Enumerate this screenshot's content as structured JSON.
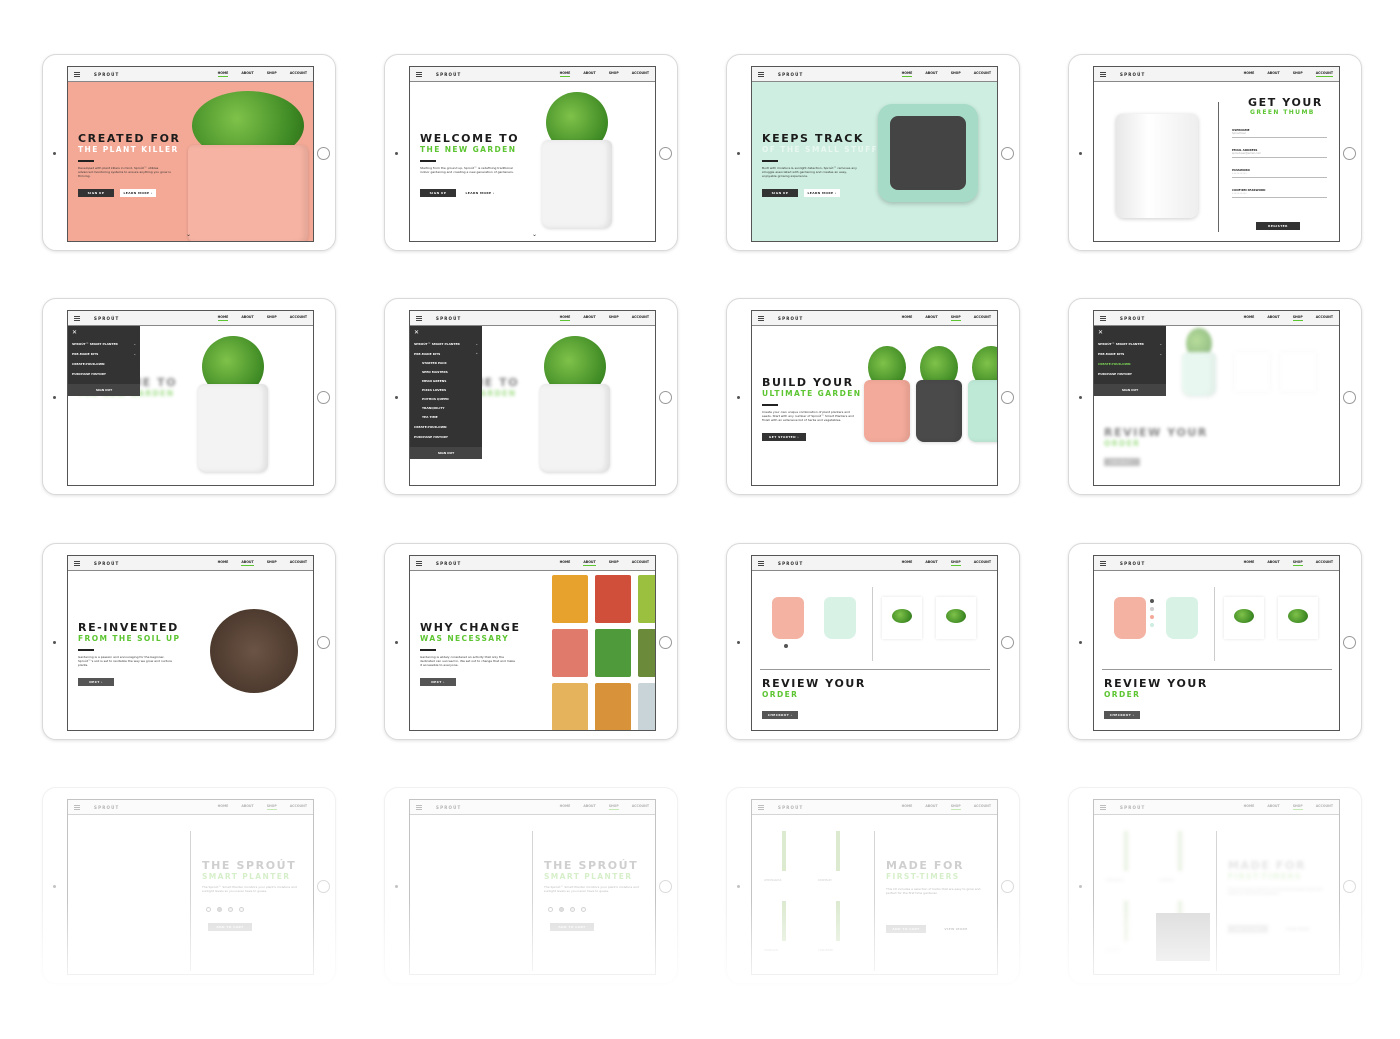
{
  "brand": "SPROÚT",
  "nav": [
    "HOME",
    "ABOUT",
    "SHOP",
    "ACCOUNT"
  ],
  "colors": {
    "accent": "#5cc531",
    "coral": "#f4a996",
    "mint": "#cdeee0",
    "dark": "#333333"
  },
  "cards": [
    {
      "view": "hero",
      "bg": "#f4a996",
      "active": 0,
      "h1": "CREATED FOR",
      "h2": "THE PLANT KILLER",
      "h2color": "#ffffff",
      "body": "Developed with plant killers in mind, Sproút™ utilizes advanced monitoring systems to ensure anything you grow is thriving.",
      "btn1": "SIGN UP",
      "btn2": "LEARN MORE ›",
      "pot": "#f6b3a3"
    },
    {
      "view": "hero",
      "bg": "#ffffff",
      "active": 0,
      "h1": "WELCOME TO",
      "h2": "THE NEW GARDEN",
      "body": "Starting from the ground up, Sproút™ is redefining traditional indoor gardening and creating a new generation of gardeners.",
      "btn1": "SIGN UP",
      "btn2": "LEARN MORE ›",
      "pot": "#f3f3f3"
    },
    {
      "view": "track",
      "bg": "#cdeee0",
      "active": 0,
      "h1": "KEEPS TRACK",
      "h2": "OF THE SMALL STUFF",
      "h2color": "#e8f8f0",
      "body": "Built with moisture & sunlight detection, Sproút™ removes any struggle associated with gardening and creates an easy, enjoyable growing experience.",
      "btn1": "SIGN UP",
      "btn2": "LEARN MORE ›"
    },
    {
      "view": "form",
      "bg": "#ffffff",
      "active": 3,
      "h1": "GET YOUR",
      "h2": "GREEN THUMB",
      "fields": [
        {
          "label": "USERNAME",
          "placeholder": "SproutUser"
        },
        {
          "label": "EMAIL ADDRESS",
          "placeholder": "sproutuser@email.com"
        },
        {
          "label": "PASSWORD",
          "placeholder": "••••••••••"
        },
        {
          "label": "CONFIRM PASSWORD",
          "placeholder": "••••••••••"
        }
      ],
      "btn1": "REGISTER"
    },
    {
      "view": "menu",
      "bg": "#ffffff",
      "active": 0,
      "h1": "WELCOME TO",
      "h2": "THE NEW GARDEN",
      "menu": [
        {
          "label": "SPROÚT™ SMART PLANTER",
          "chev": "⌄"
        },
        {
          "label": "PRE-MADE KITS",
          "chev": "⌄"
        },
        {
          "label": "CREATE-YOUR-OWN"
        },
        {
          "label": "PURCHASE HISTORY"
        }
      ],
      "signout": "SIGN OUT",
      "close": "✕",
      "pot": "#f3f3f3"
    },
    {
      "view": "menu",
      "bg": "#ffffff",
      "active": 0,
      "h1": "WELCOME TO",
      "h2": "THE NEW GARDEN",
      "menu": [
        {
          "label": "SPROÚT™ SMART PLANTER",
          "chev": "⌄"
        },
        {
          "label": "PRE-MADE KITS",
          "chev": "⌃"
        },
        {
          "label": "STARTER PACK",
          "sub": true
        },
        {
          "label": "SEED MASTERS",
          "sub": true
        },
        {
          "label": "MEAN GREENS",
          "sub": true
        },
        {
          "label": "PIZZA LOVERS",
          "sub": true
        },
        {
          "label": "POTHOS QUEEN",
          "sub": true
        },
        {
          "label": "TRANQUILITY",
          "sub": true
        },
        {
          "label": "TEA TIME",
          "sub": true
        },
        {
          "label": "CREATE-YOUR-OWN"
        },
        {
          "label": "PURCHASE HISTORY"
        }
      ],
      "signout": "SIGN OUT",
      "close": "✕",
      "pot": "#f3f3f3"
    },
    {
      "view": "three",
      "bg": "#ffffff",
      "active": 2,
      "h1": "BUILD YOUR",
      "h2": "ULTIMATE GARDEN",
      "body": "Create your own unique combination of plant planters and seeds. Start with any number of Sproút™ Smart Planters and finish with an extensive list of herbs and vegetables.",
      "btn1": "GET STARTED ›"
    },
    {
      "view": "menureview",
      "bg": "#ffffff",
      "active": 2,
      "h1": "REVIEW YOUR",
      "h2": "ORDER",
      "menu": [
        {
          "label": "SPROÚT™ SMART PLANTER",
          "chev": "⌄"
        },
        {
          "label": "PRE-MADE KITS",
          "chev": "⌄"
        },
        {
          "label": "CREATE-YOUR-OWN",
          "green": true
        },
        {
          "label": "PURCHASE HISTORY"
        }
      ],
      "signout": "SIGN OUT",
      "close": "✕",
      "btn1": "CHECKOUT ›"
    },
    {
      "view": "soil",
      "bg": "#ffffff",
      "active": 1,
      "h1": "RE-INVENTED",
      "h2": "FROM THE SOIL UP",
      "body": "Gardening is a passion and encouraging for the beginner. Sproút™'s soil is set to revitalize the way we grow and nurture plants.",
      "btn1": "NEXT ›"
    },
    {
      "view": "bags",
      "bg": "#ffffff",
      "active": 1,
      "h1": "WHY CHANGE",
      "h2": "WAS NECESSARY",
      "body": "Gardening is widely considered an activity that only the dedicated can succeed in. We set out to change that and make it accessible to everyone.",
      "btn1": "NEXT ›"
    },
    {
      "view": "review",
      "bg": "#ffffff",
      "active": 2,
      "h1": "REVIEW YOUR",
      "h2": "ORDER",
      "btn1": "CHECKOUT ›",
      "swatches": false
    },
    {
      "view": "review",
      "bg": "#ffffff",
      "active": 2,
      "h1": "REVIEW YOUR",
      "h2": "ORDER",
      "btn1": "CHECKOUT ›",
      "swatches": true
    },
    {
      "view": "product",
      "bg": "#ffffff",
      "active": 2,
      "h1": "THE SPROÚT",
      "h2": "SMART PLANTER",
      "body": "The Sproút™ Smart Planter monitors your plant's moisture and sunlight levels so you never have to guess.",
      "btn1": "ADD TO CART",
      "faded": true
    },
    {
      "view": "product",
      "bg": "#ffffff",
      "active": 2,
      "h1": "THE SPROÚT",
      "h2": "SMART PLANTER",
      "body": "The Sproút™ Smart Planter monitors your plant's moisture and sunlight levels so you never have to guess.",
      "btn1": "ADD TO CART",
      "faded": true
    },
    {
      "view": "herbs",
      "bg": "#ffffff",
      "active": 2,
      "h1": "MADE FOR",
      "h2": "FIRST-TIMERS",
      "body": "This kit includes a selection of herbs that are easy to grow and perfect for the first time gardener.",
      "btn1": "ADD TO CART",
      "btn2": "VIEW MORE",
      "herbs": [
        "LEMONGRASS",
        "ROSEMARY",
        "TARRAGON",
        "CORIANDER"
      ],
      "faded": true
    },
    {
      "view": "herbs",
      "bg": "#ffffff",
      "active": 2,
      "h1": "MADE FOR",
      "h2": "FIRST-TIMERS",
      "body": "This kit includes a selection of herbs that are easy to grow and perfect for the first time gardener.",
      "btn1": "ADD TO CART",
      "btn2": "VIEW MORE",
      "herbs": [
        "LEMONGRASS",
        "ROSEMARY",
        "TARRAGON",
        "CORIANDER"
      ],
      "faded": true,
      "blurred": true
    }
  ]
}
